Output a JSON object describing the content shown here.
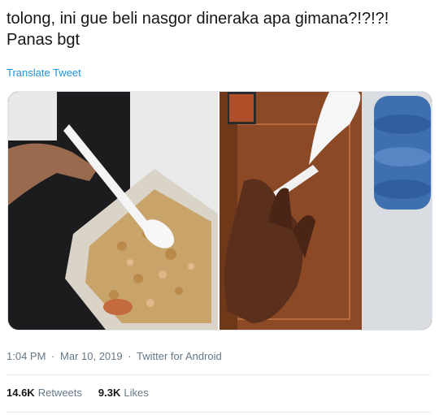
{
  "tweet": {
    "text": "tolong, ini gue beli nasgor dineraka apa gimana?!?!?!\nPanas bgt",
    "translate_label": "Translate Tweet"
  },
  "media": {
    "photos": [
      {
        "name": "photo-fried-rice-box"
      },
      {
        "name": "photo-melted-spoon"
      }
    ]
  },
  "meta": {
    "time": "1:04 PM",
    "separator": "·",
    "date": "Mar 10, 2019",
    "source": "Twitter for Android"
  },
  "stats": {
    "retweets_count": "14.6K",
    "retweets_label": "Retweets",
    "likes_count": "9.3K",
    "likes_label": "Likes"
  },
  "colors": {
    "link": "#1b95e0",
    "secondary_text": "#657786",
    "primary_text": "#14171a",
    "divider": "#e6ecf0"
  }
}
